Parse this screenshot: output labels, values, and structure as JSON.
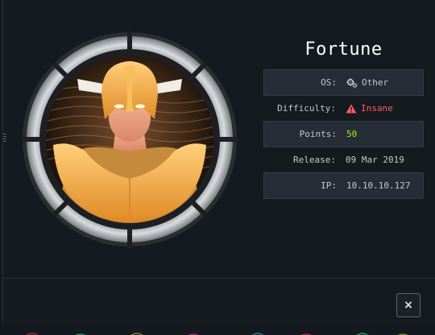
{
  "machine": {
    "name": "Fortune",
    "fields": [
      {
        "label": "OS:",
        "value": "Other",
        "icon": "gears-icon"
      },
      {
        "label": "Difficulty:",
        "value": "Insane",
        "icon": "warning-icon"
      },
      {
        "label": "Points:",
        "value": "50"
      },
      {
        "label": "Release:",
        "value": "09 Mar 2019"
      },
      {
        "label": "IP:",
        "value": "10.10.10.127"
      }
    ]
  },
  "close_button": {
    "label": "×"
  },
  "colors": {
    "background": "#141a20",
    "row_shaded": "#262d36",
    "difficulty_insane": "#ff5b5b",
    "points": "#9fef00",
    "avatar_gold": "#f0a63c",
    "ring_red": "#e02020"
  }
}
